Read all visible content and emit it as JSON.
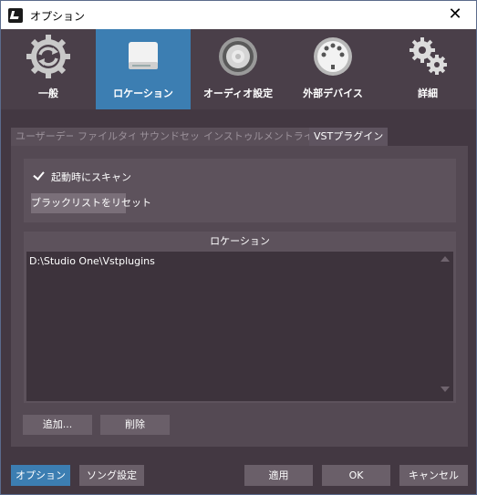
{
  "window": {
    "title": "オプション",
    "close_symbol": "✕"
  },
  "categories": [
    {
      "label": "一般",
      "icon": "sync-gear-icon",
      "active": false
    },
    {
      "label": "ロケーション",
      "icon": "drive-icon",
      "active": true
    },
    {
      "label": "オーディオ設定",
      "icon": "speaker-icon",
      "active": false
    },
    {
      "label": "外部デバイス",
      "icon": "midi-connector-icon",
      "active": false
    },
    {
      "label": "詳細",
      "icon": "gears-icon",
      "active": false
    }
  ],
  "tabs": [
    {
      "label": "ユーザーデータ",
      "active": false
    },
    {
      "label": "ファイルタイプ",
      "active": false
    },
    {
      "label": "サウンドセット",
      "active": false
    },
    {
      "label": "インストゥルメントライブラリ",
      "active": false
    },
    {
      "label": "VSTプラグイン",
      "active": true
    }
  ],
  "vst": {
    "scan_on_startup_label": "起動時にスキャン",
    "scan_on_startup_checked": true,
    "reset_blacklist_label": "ブラックリストをリセット",
    "locations_header": "ロケーション",
    "locations": [
      "D:\\Studio One\\Vstplugins"
    ],
    "add_label": "追加...",
    "remove_label": "削除"
  },
  "footer": {
    "options_label": "オプション",
    "song_settings_label": "ソング設定",
    "apply_label": "適用",
    "ok_label": "OK",
    "cancel_label": "キャンセル"
  },
  "colors": {
    "accent": "#3c7eb2",
    "background": "#433842",
    "panel": "#544953"
  }
}
